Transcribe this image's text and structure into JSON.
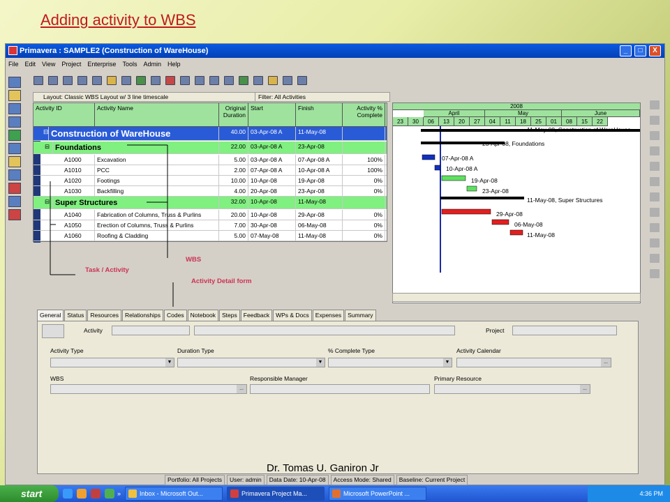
{
  "slide_title": "Adding activity to WBS",
  "window": {
    "title": "Primavera : SAMPLE2 (Construction of WareHouse)",
    "btn_min": "_",
    "btn_max": "□",
    "btn_close": "X"
  },
  "menu": [
    "File",
    "Edit",
    "View",
    "Project",
    "Enterprise",
    "Tools",
    "Admin",
    "Help"
  ],
  "layout_bar": {
    "layout": "Layout: Classic WBS Layout w/ 3 line timescale",
    "filter": "Filter: All Activities"
  },
  "columns": [
    "Activity ID",
    "Activity Name",
    "Original Duration",
    "Start",
    "Finish",
    "Activity % Complete"
  ],
  "project_row": {
    "name": "Construction of WareHouse",
    "duration": "40.00",
    "start": "03-Apr-08 A",
    "finish": "11-May-08"
  },
  "wbs": [
    {
      "name": "Foundations",
      "duration": "22.00",
      "start": "03-Apr-08 A",
      "finish": "23-Apr-08",
      "activities": [
        {
          "id": "A1000",
          "name": "Excavation",
          "dur": "5.00",
          "start": "03-Apr-08 A",
          "finish": "07-Apr-08 A",
          "pct": "100%"
        },
        {
          "id": "A1010",
          "name": "PCC",
          "dur": "2.00",
          "start": "07-Apr-08 A",
          "finish": "10-Apr-08 A",
          "pct": "100%"
        },
        {
          "id": "A1020",
          "name": "Footings",
          "dur": "10.00",
          "start": "10-Apr-08",
          "finish": "19-Apr-08",
          "pct": "0%"
        },
        {
          "id": "A1030",
          "name": "Backfilling",
          "dur": "4.00",
          "start": "20-Apr-08",
          "finish": "23-Apr-08",
          "pct": "0%"
        }
      ]
    },
    {
      "name": "Super Structures",
      "duration": "32.00",
      "start": "10-Apr-08",
      "finish": "11-May-08",
      "activities": [
        {
          "id": "A1040",
          "name": "Fabrication of Columns, Truss & Purlins",
          "dur": "20.00",
          "start": "10-Apr-08",
          "finish": "29-Apr-08",
          "pct": "0%"
        },
        {
          "id": "A1050",
          "name": "Erection of Columns, Truss & Purlins",
          "dur": "7.00",
          "start": "30-Apr-08",
          "finish": "06-May-08",
          "pct": "0%"
        },
        {
          "id": "A1060",
          "name": "Roofing & Cladding",
          "dur": "5.00",
          "start": "07-May-08",
          "finish": "11-May-08",
          "pct": "0%"
        }
      ]
    }
  ],
  "timescale": {
    "year": "2008",
    "months": [
      "April",
      "May",
      "June"
    ],
    "days": [
      "23",
      "30",
      "06",
      "13",
      "20",
      "27",
      "04",
      "11",
      "18",
      "25",
      "01",
      "08",
      "15",
      "22"
    ]
  },
  "gantt_labels": [
    "11-May-08, Construction of WareHouse",
    "23-Apr-08, Foundations",
    "07-Apr-08 A",
    "10-Apr-08 A",
    "19-Apr-08",
    "23-Apr-08",
    "11-May-08, Super Structures",
    "29-Apr-08",
    "06-May-08",
    "11-May-08"
  ],
  "annotations": {
    "wbs": "WBS",
    "task": "Task / Activity",
    "detail": "Activity Detail form"
  },
  "tabs": [
    "General",
    "Status",
    "Resources",
    "Relationships",
    "Codes",
    "Notebook",
    "Steps",
    "Feedback",
    "WPs & Docs",
    "Expenses",
    "Summary"
  ],
  "detail_labels": {
    "activity": "Activity",
    "project": "Project",
    "activity_type": "Activity Type",
    "duration_type": "Duration Type",
    "pct_type": "% Complete Type",
    "calendar": "Activity Calendar",
    "wbs": "WBS",
    "resp_manager": "Responsible Manager",
    "primary_resource": "Primary Resource",
    "ellipsis": "..."
  },
  "status": [
    "Portfolio: All Projects",
    "User: admin",
    "Data Date: 10-Apr-08",
    "Access Mode: Shared",
    "Baseline: Current Project"
  ],
  "footer": "Dr. Tomas U. Ganiron Jr",
  "taskbar": {
    "start": "start",
    "items": [
      "Inbox - Microsoft Out...",
      "Primavera Project Ma...",
      "Microsoft PowerPoint ..."
    ],
    "clock": "4:36 PM",
    "chevron": "»"
  },
  "colors": {
    "accent": "#2a5bd7",
    "wbs_band": "#80f080",
    "bar_done": "#1030c0",
    "bar_plan": "#e02020",
    "bar_green": "#60e060",
    "title_red": "#c0191e"
  }
}
